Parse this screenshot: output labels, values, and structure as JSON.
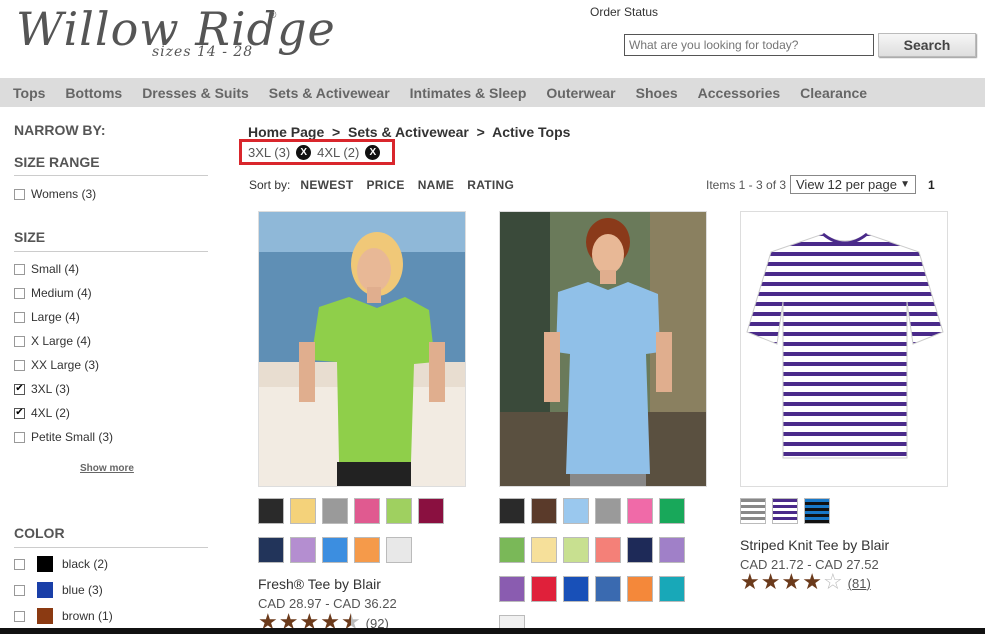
{
  "header": {
    "logo_main": "Willow Ridge",
    "logo_sub": "sizes 14 - 28",
    "order_status": "Order Status",
    "search_placeholder": "What are you looking for today?",
    "search_button": "Search"
  },
  "nav": [
    "Tops",
    "Bottoms",
    "Dresses & Suits",
    "Sets & Activewear",
    "Intimates & Sleep",
    "Outerwear",
    "Shoes",
    "Accessories",
    "Clearance"
  ],
  "sidebar": {
    "narrow_by": "NARROW BY:",
    "size_range": {
      "heading": "SIZE RANGE",
      "items": [
        {
          "label": "Womens (3)",
          "checked": false
        }
      ]
    },
    "size": {
      "heading": "SIZE",
      "items": [
        {
          "label": "Small (4)",
          "checked": false
        },
        {
          "label": "Medium (4)",
          "checked": false
        },
        {
          "label": "Large (4)",
          "checked": false
        },
        {
          "label": "X Large (4)",
          "checked": false
        },
        {
          "label": "XX Large (3)",
          "checked": false
        },
        {
          "label": "3XL (3)",
          "checked": true
        },
        {
          "label": "4XL (2)",
          "checked": true
        },
        {
          "label": "Petite Small (3)",
          "checked": false
        }
      ],
      "show_more": "Show more"
    },
    "color": {
      "heading": "COLOR",
      "items": [
        {
          "label": "black (2)",
          "swatch": "#000000"
        },
        {
          "label": "blue (3)",
          "swatch": "#1a3fa8"
        },
        {
          "label": "brown (1)",
          "swatch": "#8b3a12"
        }
      ]
    }
  },
  "breadcrumb": {
    "home": "Home Page",
    "sep": ">",
    "category": "Sets & Activewear",
    "current": "Active Tops"
  },
  "active_filters": [
    {
      "label": "3XL (3)",
      "remove": "X"
    },
    {
      "label": "4XL (2)",
      "remove": "X"
    }
  ],
  "sort": {
    "label": "Sort by:",
    "options": [
      "NEWEST",
      "PRICE",
      "NAME",
      "RATING"
    ]
  },
  "pagination": {
    "items_count": "Items 1 - 3 of 3",
    "per_page": "View 12 per page",
    "page": "1"
  },
  "products": [
    {
      "name": "Fresh® Tee by Blair",
      "price": "CAD 28.97 - CAD 36.22",
      "rating": 4.5,
      "reviews": "(92)",
      "swatches": [
        "#2a2a2a",
        "#f4d27a",
        "#9a9a9a",
        "#e05a90",
        "#9fd060",
        "#8a1040",
        "#22345a",
        "#b48ed0",
        "#3c8ee0",
        "#f59a4a",
        "#e8e8e8"
      ]
    },
    {
      "name": "",
      "price": "",
      "rating": 0,
      "reviews": "",
      "swatches": [
        "#2a2a2a",
        "#5a3a2a",
        "#9ac8ee",
        "#9a9a9a",
        "#f06aa8",
        "#18a85a",
        "#7ab858",
        "#f6e09a",
        "#c8e090",
        "#f48078",
        "#1e2a58",
        "#a080c8",
        "#8a5cb0",
        "#e0203a",
        "#1850b8",
        "#3a6ab0",
        "#f4883a",
        "#18a8b8",
        "#f0f0f0"
      ]
    },
    {
      "name": "Striped Knit Tee by Blair",
      "price": "CAD 21.72 - CAD 27.52",
      "rating": 4,
      "reviews": "(81)",
      "swatches": [
        "stripe-gray",
        "stripe-purple",
        "stripe-blue"
      ]
    }
  ]
}
